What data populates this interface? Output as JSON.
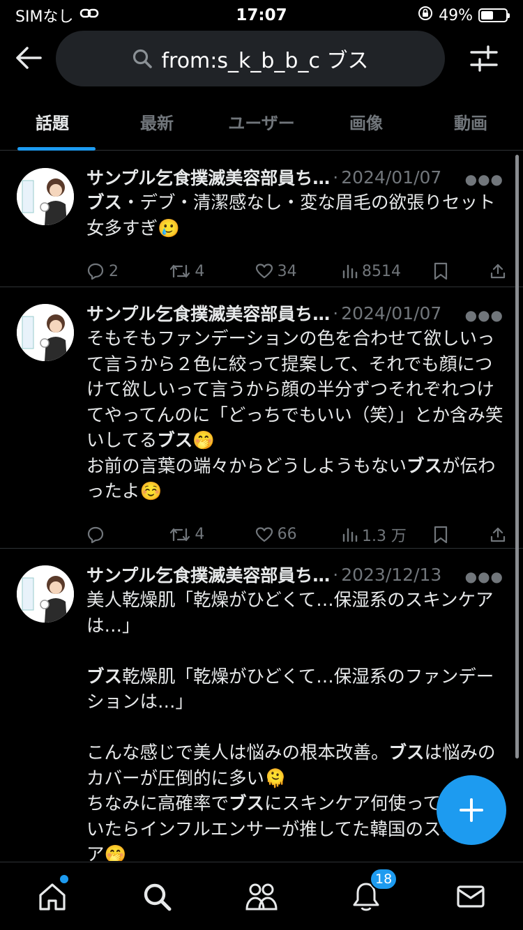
{
  "status_bar": {
    "carrier": "SIMなし",
    "time": "17:07",
    "battery_percent": "49%",
    "battery_level": 0.49
  },
  "search": {
    "query": "from:s_k_b_b_c ブス"
  },
  "tabs": [
    {
      "label": "話題",
      "active": true
    },
    {
      "label": "最新",
      "active": false
    },
    {
      "label": "ユーザー",
      "active": false
    },
    {
      "label": "画像",
      "active": false
    },
    {
      "label": "動画",
      "active": false
    }
  ],
  "tweets": [
    {
      "author": "サンプル乞食撲滅美容部員ち…",
      "date": "2024/01/07",
      "body_segments": [
        {
          "text": "ブス",
          "bold": true
        },
        {
          "text": "・デブ・清潔感なし・変な眉毛の欲張りセット女多すぎ",
          "bold": false
        }
      ],
      "emoji": "crying-face",
      "stats": {
        "replies": "2",
        "retweets": "4",
        "likes": "34",
        "views": "8514"
      }
    },
    {
      "author": "サンプル乞食撲滅美容部員ち…",
      "date": "2024/01/07",
      "body_segments": [
        {
          "text": "そもそもファンデーションの色を合わせて欲しいって言うから２色に絞って提案して、それでも顔につけて欲しいって言うから顔の半分ずつそれぞれつけてやってんのに「どっちでもいい（笑）」とか含み笑いしてる",
          "bold": false
        },
        {
          "text": "ブス",
          "bold": true
        },
        {
          "text": "🤭\nお前の言葉の端々からどうしようもない",
          "bold": false
        },
        {
          "text": "ブス",
          "bold": true
        },
        {
          "text": "が伝わったよ☺️",
          "bold": false
        }
      ],
      "stats": {
        "replies": "",
        "retweets": "4",
        "likes": "66",
        "views": "1.3 万"
      }
    },
    {
      "author": "サンプル乞食撲滅美容部員ち…",
      "date": "2023/12/13",
      "body_segments": [
        {
          "text": "美人乾燥肌「乾燥がひどくて…保湿系のスキンケアは…」\n\n",
          "bold": false
        },
        {
          "text": "ブス",
          "bold": true
        },
        {
          "text": "乾燥肌「乾燥がひどくて…保湿系のファンデーションは…」\n\nこんな感じで美人は悩みの根本改善。",
          "bold": false
        },
        {
          "text": "ブス",
          "bold": true
        },
        {
          "text": "は悩みのカバーが圧倒的に多い🫠\nちなみに高確率で",
          "bold": false
        },
        {
          "text": "ブス",
          "bold": true
        },
        {
          "text": "にスキンケア何使ってるか聞いたらインフルエンサーが推してた韓国のスキンケア🤭",
          "bold": false
        }
      ]
    }
  ],
  "bottom_nav": {
    "notifications_badge": "18"
  },
  "colors": {
    "accent": "#1d9bf0",
    "background": "#000000",
    "muted": "#71767b"
  }
}
